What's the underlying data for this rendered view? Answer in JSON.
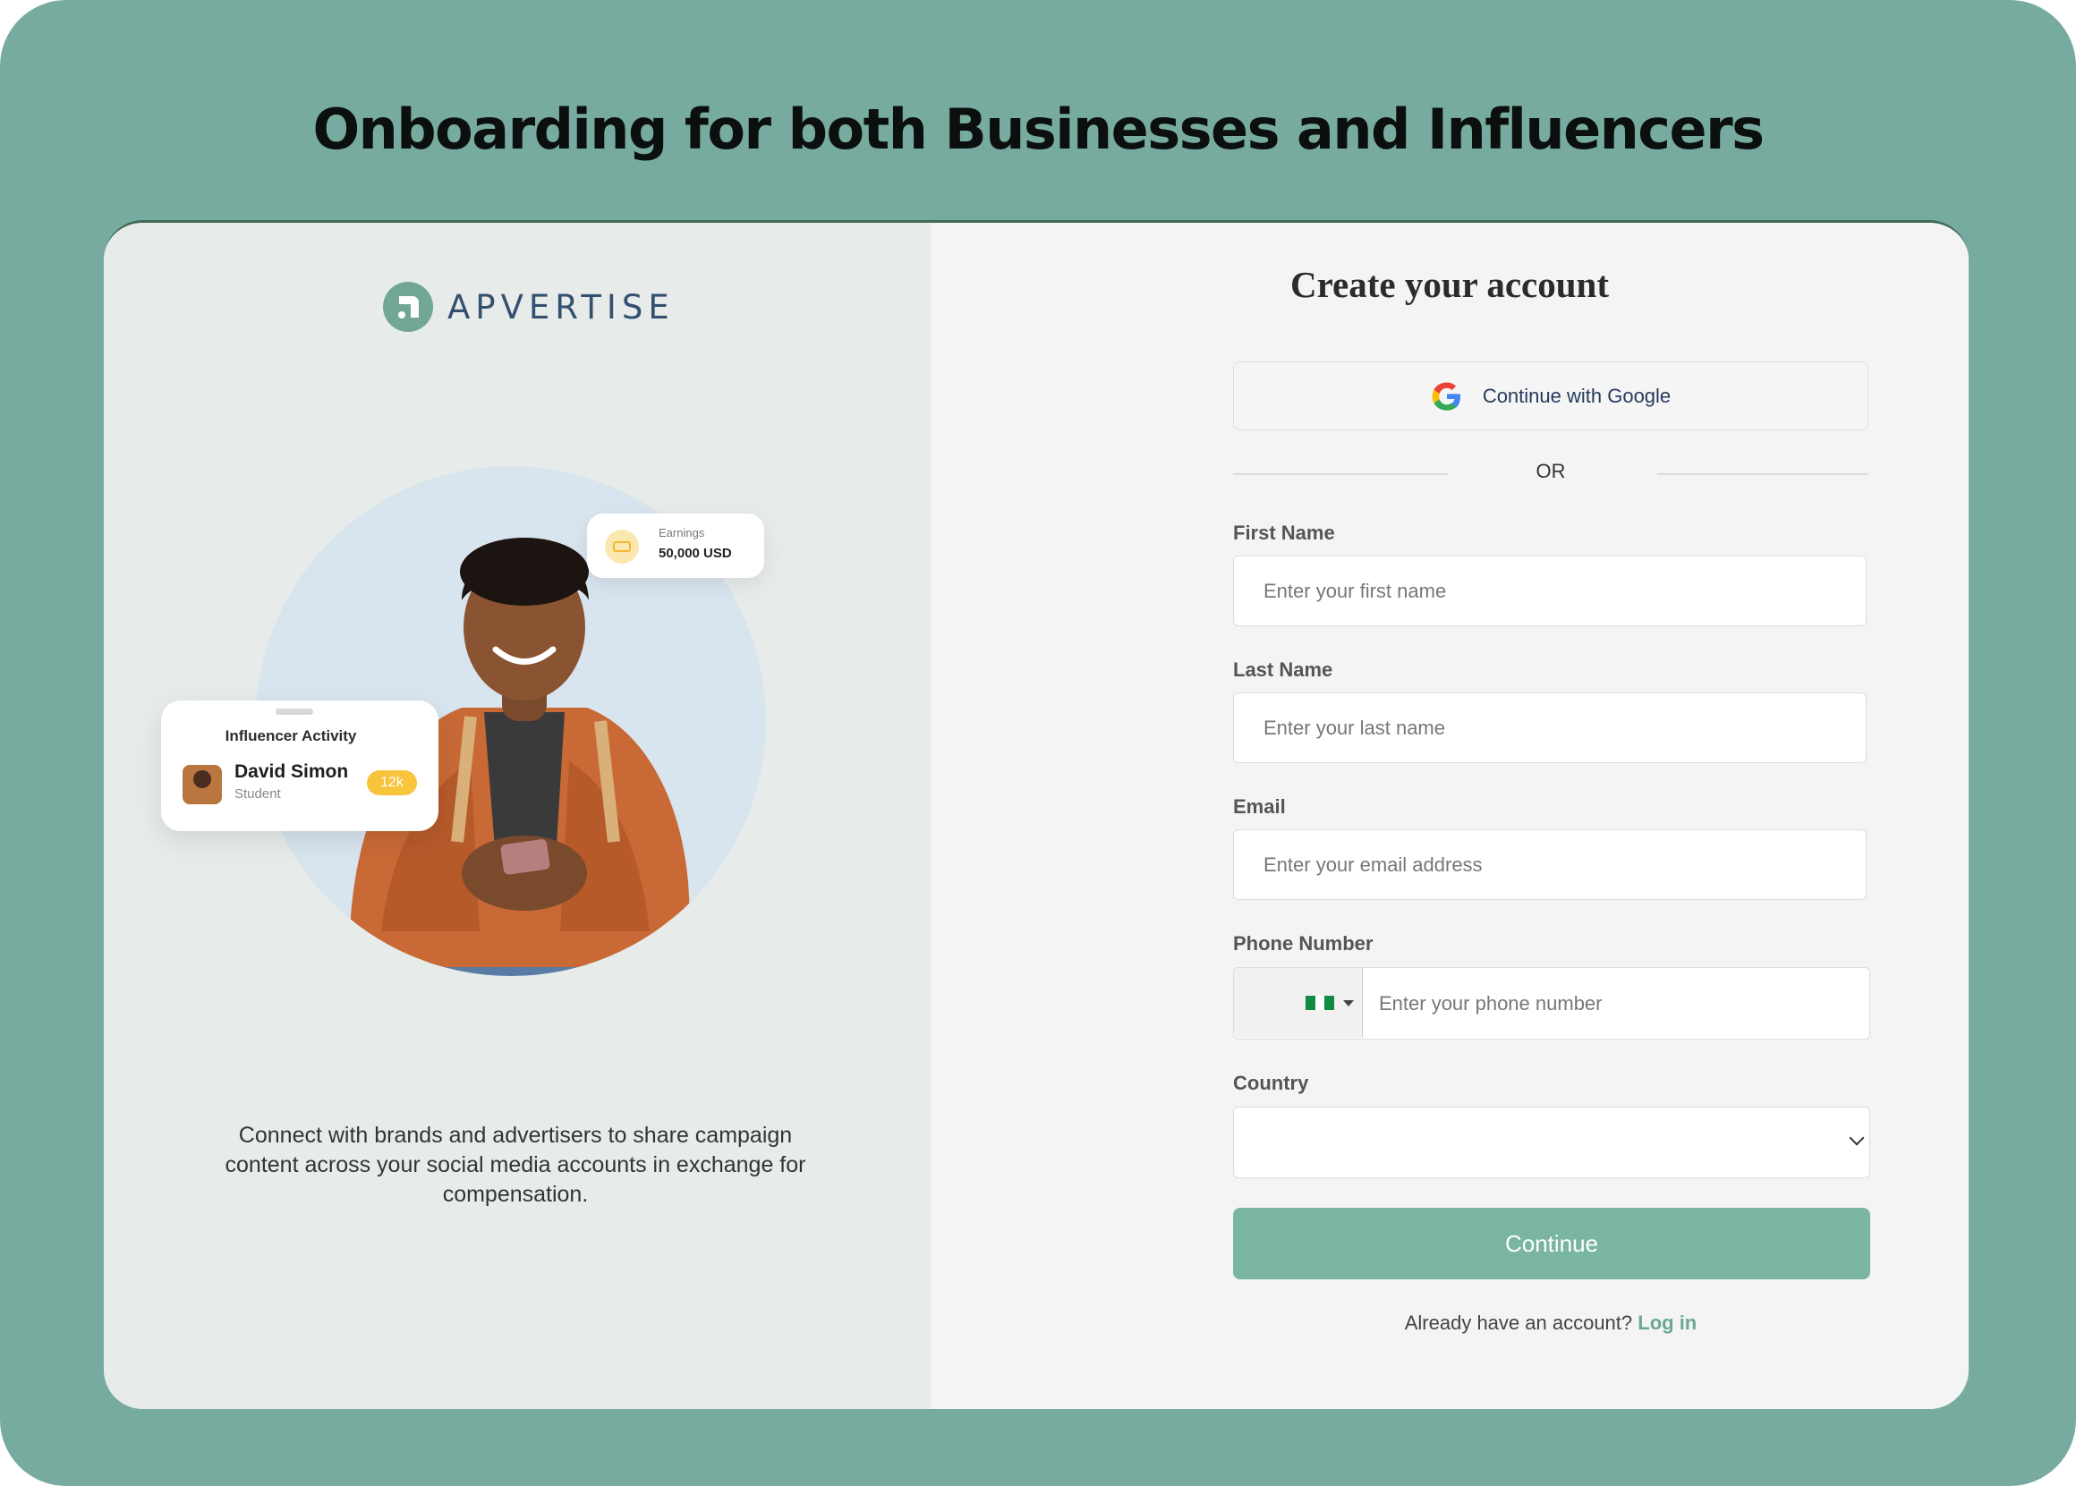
{
  "headline": "Onboarding for both Businesses and Influencers",
  "brand": {
    "name": "APVERTISE",
    "icon": "apvertise-logo-icon",
    "color": "#72a796"
  },
  "hero": {
    "earnings_label": "Earnings",
    "earnings_value": "50,000 USD",
    "activity_title": "Influencer Activity",
    "activity_name": "David Simon",
    "activity_role": "Student",
    "activity_badge": "12k",
    "tagline": "Connect with brands and advertisers to share campaign content across your social media accounts in exchange for compensation."
  },
  "form": {
    "title": "Create your account",
    "google_label": "Continue with Google",
    "or_text": "OR",
    "first_name_label": "First Name",
    "first_name_placeholder": "Enter your first name",
    "last_name_label": "Last Name",
    "last_name_placeholder": "Enter your last name",
    "email_label": "Email",
    "email_placeholder": "Enter your email address",
    "phone_label": "Phone Number",
    "phone_placeholder": "Enter your phone number",
    "phone_country_flag": "nigeria-flag-icon",
    "country_label": "Country",
    "continue_label": "Continue",
    "login_prompt": "Already have an account?",
    "login_link": "Log in"
  },
  "colors": {
    "background": "#78ab9f",
    "accent": "#79b5a2",
    "link": "#6aa895",
    "left_panel": "#e7ecea",
    "right_panel": "#f4f4f4"
  }
}
